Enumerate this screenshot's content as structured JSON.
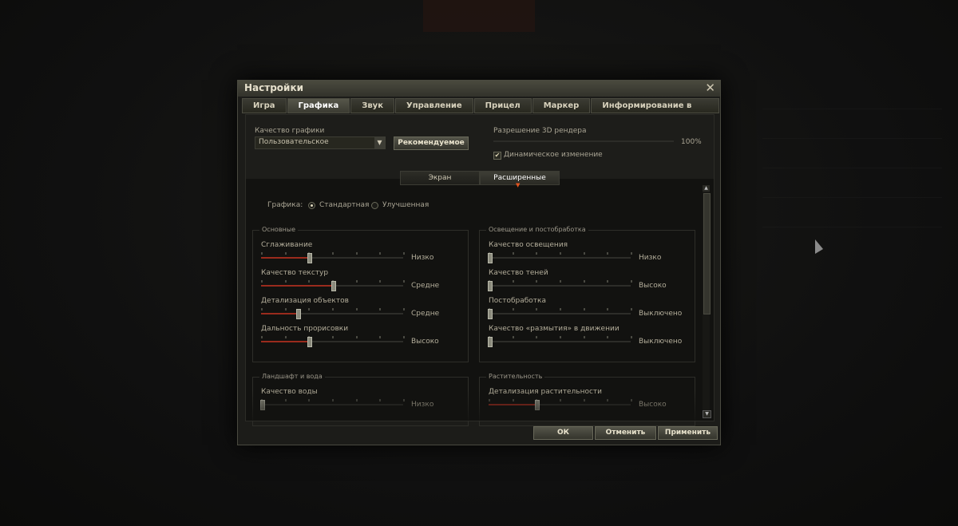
{
  "dialog": {
    "title": "Настройки"
  },
  "tabs": [
    "Игра",
    "Графика",
    "Звук",
    "Управление",
    "Прицел",
    "Маркер",
    "Информирование в бою"
  ],
  "active_tab": "Графика",
  "quality": {
    "label": "Качество графики",
    "value": "Пользовательское",
    "recommended_button": "Рекомендуемое"
  },
  "render": {
    "label": "Разрешение 3D рендера",
    "percent_text": "100%",
    "dynamic_label": "Динамическое изменение",
    "dynamic_checked": true
  },
  "subtabs": [
    "Экран",
    "Расширенные"
  ],
  "graphics_mode": {
    "label": "Графика:",
    "standard": "Стандартная",
    "improved": "Улучшенная",
    "selected": "standard"
  },
  "groups": {
    "basic": {
      "title": "Основные",
      "rows": [
        {
          "name": "Сглаживание",
          "value": "Низко",
          "level": 0.33
        },
        {
          "name": "Качество текстур",
          "value": "Средне",
          "level": 0.5
        },
        {
          "name": "Детализация объектов",
          "value": "Средне",
          "level": 0.25
        },
        {
          "name": "Дальность прорисовки",
          "value": "Высоко",
          "level": 0.33
        }
      ]
    },
    "lighting": {
      "title": "Освещение и постобработка",
      "rows": [
        {
          "name": "Качество освещения",
          "value": "Низко",
          "level": 0.0
        },
        {
          "name": "Качество теней",
          "value": "Высоко",
          "level": 0.0
        },
        {
          "name": "Постобработка",
          "value": "Выключено",
          "level": 0.0
        },
        {
          "name": "Качество «размытия» в движении",
          "value": "Выключено",
          "level": 0.0
        }
      ]
    },
    "landscape": {
      "title": "Ландшафт и вода",
      "rows": [
        {
          "name": "Качество воды",
          "value": "Низко",
          "level": 0.0
        }
      ]
    },
    "vegetation": {
      "title": "Растительность",
      "rows": [
        {
          "name": "Детализация растительности",
          "value": "Высоко",
          "level": 0.33
        }
      ]
    }
  },
  "footer": {
    "ok": "ОК",
    "cancel": "Отменить",
    "apply": "Применить"
  },
  "colors": {
    "accent": "#9a2b1d",
    "notch": "#e2521d"
  }
}
